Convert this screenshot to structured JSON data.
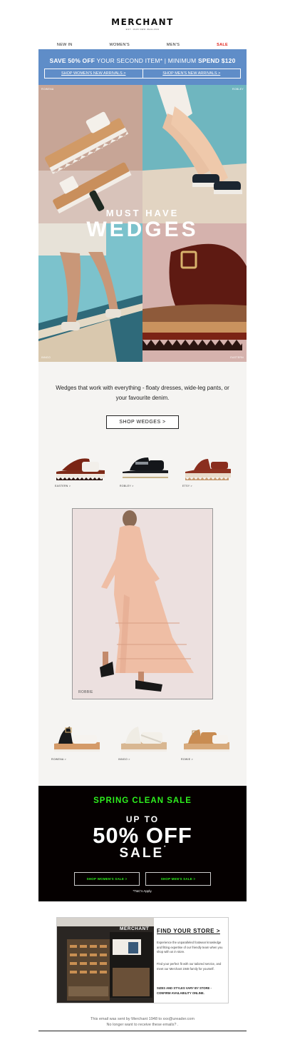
{
  "header": {
    "logo": "MERCHANT",
    "logo_sub": "EST. 1948 NEW ZEALAND"
  },
  "nav": {
    "items": [
      "NEW IN",
      "WOMEN'S",
      "MEN'S",
      "SALE"
    ]
  },
  "promo": {
    "save_bold": "SAVE 50% OFF",
    "save_rest": " YOUR SECOND ITEM*  |  MINIMUM ",
    "spend_bold": "SPEND $120",
    "btn_women": "SHOP WOMEN'S NEW ARRIVALS >",
    "btn_men": "SHOP MEN'S NEW ARRIVALS >",
    "color": "#5f8dc8"
  },
  "hero": {
    "title_small": "MUST HAVE",
    "title_big": "WEDGES",
    "labels": [
      "ROWENA",
      "ROBLEY",
      "INNGO",
      "EASTERN"
    ]
  },
  "intro": {
    "tagline": "Wedges that work with everything - floaty dresses, wide-leg pants, or your favourite denim.",
    "shop_button": "SHOP WEDGES >"
  },
  "products_top": [
    {
      "label": "EASTERN >",
      "icon": "wedge-sandal-brown-icon"
    },
    {
      "label": "ROBLEY >",
      "icon": "wedge-sandal-black-icon"
    },
    {
      "label": "ETSY >",
      "icon": "wedge-sandal-tan-icon"
    }
  ],
  "model": {
    "label": "ROBBIE"
  },
  "products_bottom": [
    {
      "label": "ROWENA >",
      "icon": "wedge-sandal-black-tan-icon"
    },
    {
      "label": "INNGO >",
      "icon": "wedge-sandal-white-icon"
    },
    {
      "label": "ROWIE >",
      "icon": "wedge-sandal-tan-white-icon"
    }
  ],
  "sale": {
    "headline": "SPRING CLEAN SALE",
    "up_to": "UP TO",
    "percent": "50% OFF",
    "word": "SALE",
    "asterisk": "*",
    "btn_women": "SHOP WOMEN'S SALE >",
    "btn_men": "SHOP MEN'S SALE >",
    "tcs": "*T&C's Apply.",
    "accent": "#2ef11e"
  },
  "store": {
    "title": "FIND YOUR STORE >",
    "photo_sign": "MERCHANT",
    "p1": "Experience the unparalleled footwear knowledge and fitting expertise of our friendly team when you shop with us in store.",
    "p2": "Find your perfect fit with our tailored service, and meet our Merchant 1948 family for yourself.",
    "p3": "SIZES AND STYLES VARY BY STORE - CONFIRM AVAILABILITY ONLINE."
  },
  "footer": {
    "line1": "This email was sent by Merchant 1948 to xxx@ureader.com",
    "line2": "No longer want to receive these emails? ."
  }
}
